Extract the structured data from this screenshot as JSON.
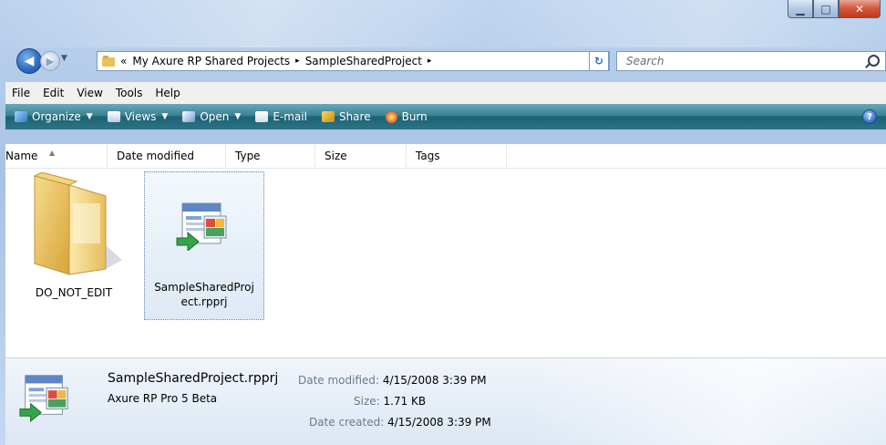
{
  "window": {
    "caption": {
      "minimize": "▁",
      "maximize": "□",
      "close": "✕"
    }
  },
  "nav": {
    "back_icon": "arrow-left-icon",
    "forward_icon": "arrow-right-icon",
    "address": {
      "overflow": "«",
      "segments": [
        "My Axure RP Shared Projects",
        "SampleSharedProject"
      ],
      "separator": "▸"
    },
    "search": {
      "placeholder": "Search"
    }
  },
  "menu": {
    "items": [
      "File",
      "Edit",
      "View",
      "Tools",
      "Help"
    ]
  },
  "toolbar": {
    "organize": "Organize",
    "views": "Views",
    "open": "Open",
    "email": "E-mail",
    "share": "Share",
    "burn": "Burn",
    "help": "?"
  },
  "columns": [
    "Name",
    "Date modified",
    "Type",
    "Size",
    "Tags"
  ],
  "items": [
    {
      "name": "DO_NOT_EDIT",
      "kind": "folder"
    },
    {
      "name_line1": "SampleSharedProj",
      "name_line2": "ect.rpprj",
      "kind": "rpprj-file"
    }
  ],
  "details": {
    "filename": "SampleSharedProject.rpprj",
    "app": "Axure RP Pro 5 Beta",
    "date_modified_label": "Date modified:",
    "date_modified": "4/15/2008 3:39 PM",
    "size_label": "Size:",
    "size": "1.71 KB",
    "date_created_label": "Date created:",
    "date_created": "4/15/2008 3:39 PM"
  },
  "colors": {
    "command_bar": "#2c7486",
    "frame": "#b4cbe8",
    "close_button": "#c0391d"
  }
}
